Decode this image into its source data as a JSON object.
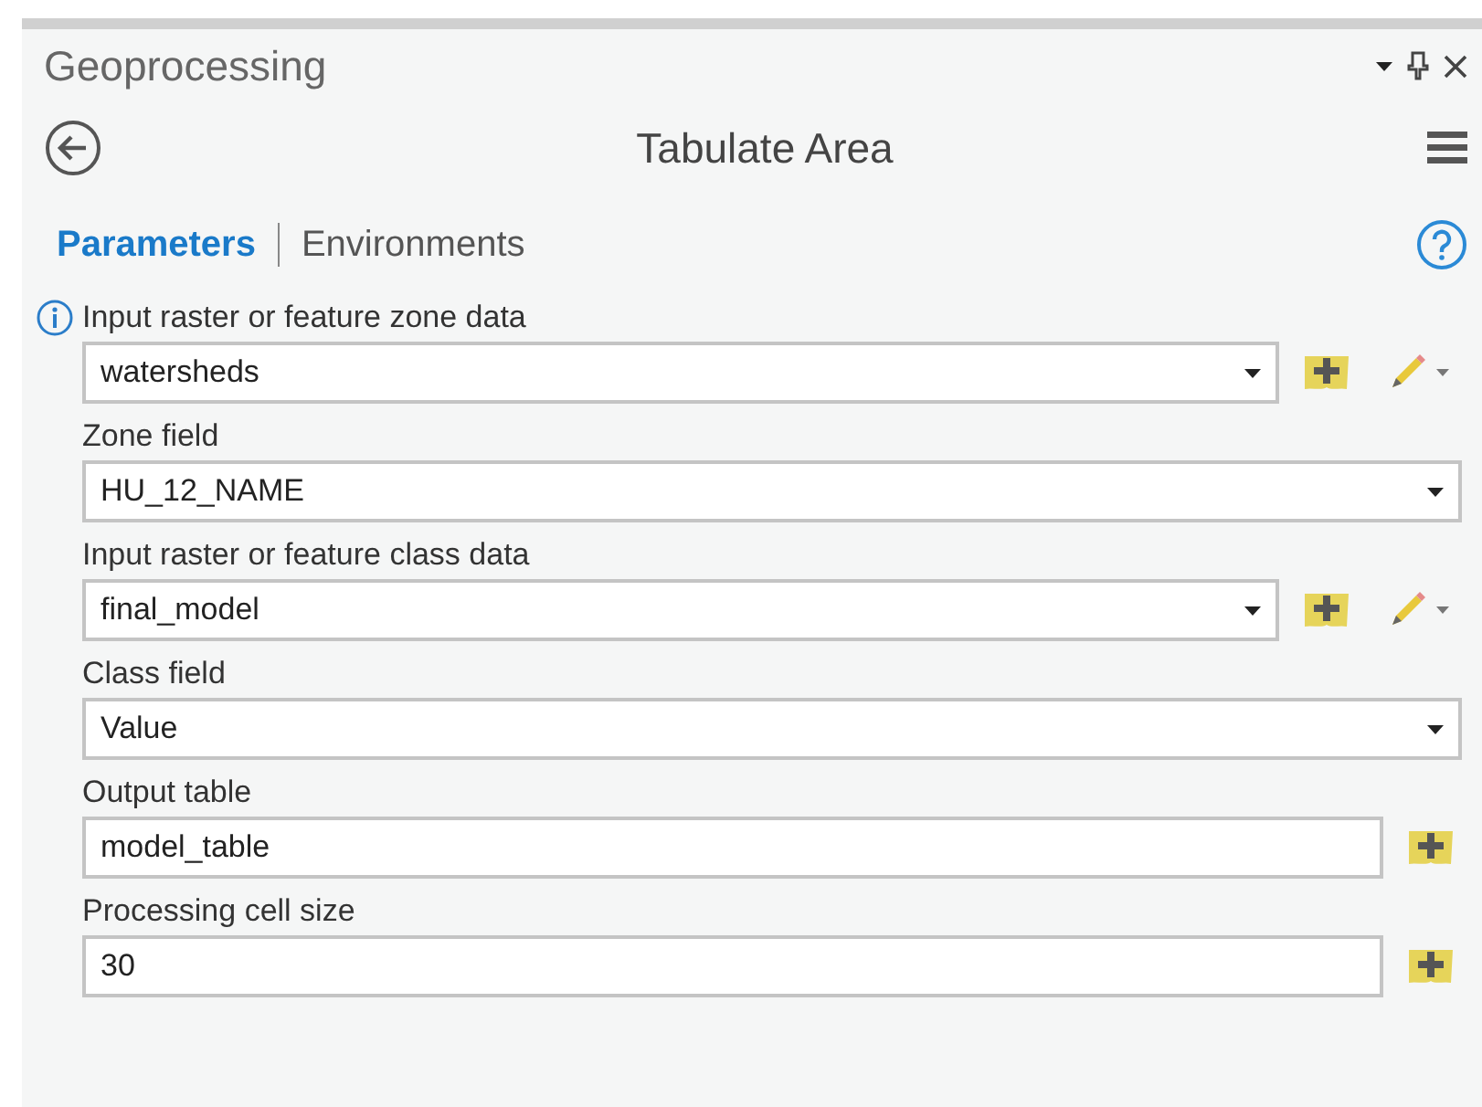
{
  "pane": {
    "title": "Geoprocessing"
  },
  "tool": {
    "title": "Tabulate Area"
  },
  "tabs": [
    {
      "label": "Parameters",
      "selected": true
    },
    {
      "label": "Environments",
      "selected": false
    }
  ],
  "parameters": [
    {
      "label": "Input raster or feature zone data",
      "value": "watersheds",
      "kind": "dropdown",
      "info": true,
      "browse": true,
      "edit": true
    },
    {
      "label": "Zone field",
      "value": "HU_12_NAME",
      "kind": "dropdown",
      "info": false,
      "browse": false,
      "edit": false
    },
    {
      "label": "Input raster or feature class data",
      "value": "final_model",
      "kind": "dropdown",
      "info": false,
      "browse": true,
      "edit": true
    },
    {
      "label": "Class field",
      "value": "Value",
      "kind": "dropdown",
      "info": false,
      "browse": false,
      "edit": false
    },
    {
      "label": "Output table",
      "value": "model_table",
      "kind": "text",
      "info": false,
      "browse": true,
      "edit": false
    },
    {
      "label": "Processing cell size",
      "value": "30",
      "kind": "text",
      "info": false,
      "browse": true,
      "edit": false
    }
  ]
}
